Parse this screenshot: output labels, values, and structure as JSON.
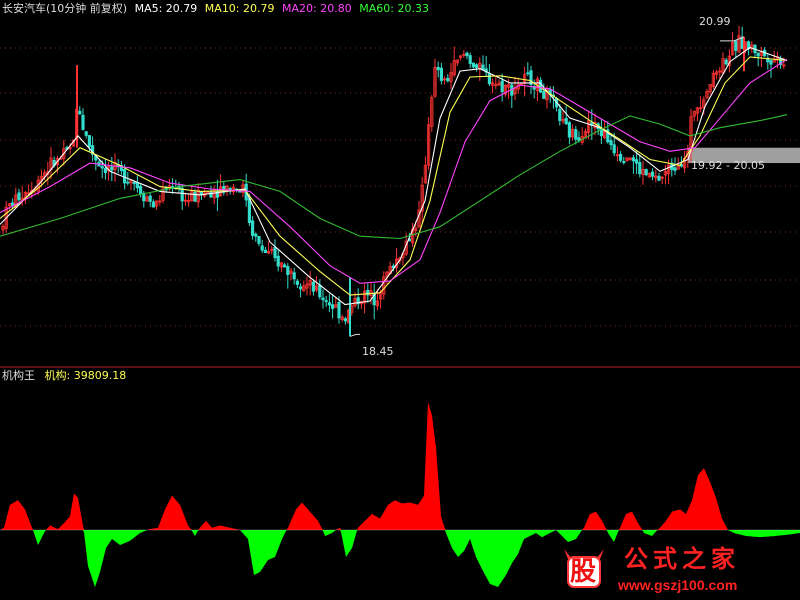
{
  "main_header": {
    "title": "长安汽车(10分钟 前复权)",
    "ma": [
      {
        "label": "MA5: 20.79",
        "color": "#ffffff"
      },
      {
        "label": "MA10: 20.79",
        "color": "#ffff55"
      },
      {
        "label": "MA20: 20.80",
        "color": "#ff44ff"
      },
      {
        "label": "MA60: 20.33",
        "color": "#33ff33"
      }
    ]
  },
  "annotations": {
    "high": "20.99",
    "low": "18.45",
    "range": "19.92 - 20.05"
  },
  "sub_header": {
    "title": "机构王",
    "indicator": "机构: 39809.18"
  },
  "watermark": {
    "logo_char": "股",
    "name": "公式之家",
    "url": "www.gszj100.com"
  },
  "colors": {
    "up": "#ff3333",
    "down": "#33ddcc",
    "pos": "#ff0000",
    "neg": "#00ff00",
    "ma5": "#ffffff",
    "ma10": "#ffff55",
    "ma20": "#ff44ff",
    "ma60": "#33bb33",
    "grid": "#882222",
    "divider": "#bb2222"
  },
  "chart_data": [
    {
      "type": "candlestick",
      "title": "长安汽车(10分钟 前复权)",
      "ylim": [
        18.25,
        21.15
      ],
      "series": [
        {
          "name": "MA5",
          "values": [
            20.79
          ]
        },
        {
          "name": "MA10",
          "values": [
            20.79
          ]
        },
        {
          "name": "MA20",
          "values": [
            20.8
          ]
        },
        {
          "name": "MA60",
          "values": [
            20.33
          ]
        }
      ],
      "high": 20.99,
      "low": 18.45,
      "range_box": [
        19.92,
        20.05
      ],
      "price_path": [
        [
          0,
          19.35
        ],
        [
          8,
          19.55
        ],
        [
          20,
          19.65
        ],
        [
          35,
          19.75
        ],
        [
          50,
          19.9
        ],
        [
          60,
          19.95
        ],
        [
          72,
          20.05
        ],
        [
          78,
          20.45
        ],
        [
          82,
          20.25
        ],
        [
          90,
          20.05
        ],
        [
          100,
          19.9
        ],
        [
          115,
          19.85
        ],
        [
          130,
          19.8
        ],
        [
          145,
          19.65
        ],
        [
          155,
          19.55
        ],
        [
          165,
          19.7
        ],
        [
          175,
          19.75
        ],
        [
          185,
          19.6
        ],
        [
          200,
          19.65
        ],
        [
          215,
          19.7
        ],
        [
          230,
          19.72
        ],
        [
          245,
          19.7
        ],
        [
          250,
          19.4
        ],
        [
          260,
          19.2
        ],
        [
          275,
          19.1
        ],
        [
          290,
          19.0
        ],
        [
          305,
          18.9
        ],
        [
          320,
          18.8
        ],
        [
          335,
          18.7
        ],
        [
          345,
          18.6
        ],
        [
          355,
          18.75
        ],
        [
          365,
          18.8
        ],
        [
          375,
          18.78
        ],
        [
          385,
          18.95
        ],
        [
          400,
          19.15
        ],
        [
          410,
          19.3
        ],
        [
          420,
          19.5
        ],
        [
          425,
          19.9
        ],
        [
          430,
          20.4
        ],
        [
          435,
          20.7
        ],
        [
          445,
          20.6
        ],
        [
          455,
          20.75
        ],
        [
          465,
          20.85
        ],
        [
          480,
          20.7
        ],
        [
          495,
          20.6
        ],
        [
          510,
          20.55
        ],
        [
          520,
          20.6
        ],
        [
          530,
          20.65
        ],
        [
          540,
          20.55
        ],
        [
          555,
          20.4
        ],
        [
          565,
          20.2
        ],
        [
          575,
          20.15
        ],
        [
          590,
          20.25
        ],
        [
          600,
          20.2
        ],
        [
          610,
          20.1
        ],
        [
          620,
          20.0
        ],
        [
          630,
          19.98
        ],
        [
          640,
          19.85
        ],
        [
          650,
          19.8
        ],
        [
          660,
          19.78
        ],
        [
          670,
          19.88
        ],
        [
          680,
          19.95
        ],
        [
          688,
          20.0
        ],
        [
          692,
          20.35
        ],
        [
          700,
          20.45
        ],
        [
          710,
          20.6
        ],
        [
          720,
          20.75
        ],
        [
          730,
          20.85
        ],
        [
          740,
          20.95
        ],
        [
          750,
          20.9
        ],
        [
          760,
          20.85
        ],
        [
          770,
          20.82
        ],
        [
          780,
          20.8
        ],
        [
          787,
          20.75
        ]
      ],
      "ma_paths": {
        "MA5": [
          [
            0,
            19.4
          ],
          [
            40,
            19.75
          ],
          [
            78,
            20.15
          ],
          [
            110,
            19.85
          ],
          [
            160,
            19.68
          ],
          [
            200,
            19.65
          ],
          [
            245,
            19.7
          ],
          [
            270,
            19.25
          ],
          [
            310,
            18.95
          ],
          [
            345,
            18.72
          ],
          [
            370,
            18.75
          ],
          [
            400,
            19.1
          ],
          [
            425,
            19.6
          ],
          [
            440,
            20.3
          ],
          [
            460,
            20.7
          ],
          [
            480,
            20.72
          ],
          [
            510,
            20.6
          ],
          [
            540,
            20.6
          ],
          [
            570,
            20.3
          ],
          [
            600,
            20.22
          ],
          [
            630,
            20.05
          ],
          [
            660,
            19.85
          ],
          [
            688,
            19.95
          ],
          [
            705,
            20.4
          ],
          [
            730,
            20.78
          ],
          [
            750,
            20.9
          ],
          [
            787,
            20.79
          ]
        ],
        "MA10": [
          [
            0,
            19.45
          ],
          [
            40,
            19.72
          ],
          [
            80,
            20.05
          ],
          [
            120,
            19.9
          ],
          [
            160,
            19.72
          ],
          [
            200,
            19.68
          ],
          [
            245,
            19.69
          ],
          [
            280,
            19.3
          ],
          [
            320,
            19.0
          ],
          [
            350,
            18.8
          ],
          [
            380,
            18.82
          ],
          [
            410,
            19.1
          ],
          [
            430,
            19.6
          ],
          [
            450,
            20.35
          ],
          [
            470,
            20.65
          ],
          [
            500,
            20.66
          ],
          [
            530,
            20.62
          ],
          [
            560,
            20.45
          ],
          [
            590,
            20.28
          ],
          [
            620,
            20.12
          ],
          [
            650,
            19.95
          ],
          [
            680,
            19.9
          ],
          [
            700,
            20.15
          ],
          [
            725,
            20.6
          ],
          [
            750,
            20.82
          ],
          [
            787,
            20.79
          ]
        ],
        "MA20": [
          [
            0,
            19.5
          ],
          [
            50,
            19.72
          ],
          [
            90,
            19.92
          ],
          [
            130,
            19.88
          ],
          [
            170,
            19.75
          ],
          [
            210,
            19.7
          ],
          [
            250,
            19.68
          ],
          [
            290,
            19.38
          ],
          [
            330,
            19.05
          ],
          [
            360,
            18.9
          ],
          [
            390,
            18.92
          ],
          [
            420,
            19.1
          ],
          [
            440,
            19.5
          ],
          [
            465,
            20.1
          ],
          [
            490,
            20.45
          ],
          [
            520,
            20.58
          ],
          [
            550,
            20.55
          ],
          [
            580,
            20.4
          ],
          [
            610,
            20.25
          ],
          [
            640,
            20.1
          ],
          [
            670,
            20.02
          ],
          [
            695,
            20.05
          ],
          [
            720,
            20.3
          ],
          [
            750,
            20.6
          ],
          [
            787,
            20.8
          ]
        ],
        "MA60": [
          [
            0,
            19.3
          ],
          [
            60,
            19.45
          ],
          [
            120,
            19.62
          ],
          [
            180,
            19.72
          ],
          [
            240,
            19.78
          ],
          [
            280,
            19.68
          ],
          [
            320,
            19.45
          ],
          [
            360,
            19.3
          ],
          [
            400,
            19.28
          ],
          [
            440,
            19.38
          ],
          [
            480,
            19.6
          ],
          [
            520,
            19.82
          ],
          [
            560,
            20.02
          ],
          [
            600,
            20.2
          ],
          [
            630,
            20.32
          ],
          [
            660,
            20.25
          ],
          [
            690,
            20.15
          ],
          [
            720,
            20.22
          ],
          [
            760,
            20.28
          ],
          [
            787,
            20.33
          ]
        ]
      }
    },
    {
      "type": "area",
      "title": "机构王",
      "series": [
        {
          "name": "机构",
          "values": [
            39809.18
          ]
        }
      ],
      "ylim": [
        -1,
        3.1
      ],
      "path": [
        [
          0,
          0
        ],
        [
          4,
          0.05
        ],
        [
          10,
          0.55
        ],
        [
          18,
          0.65
        ],
        [
          25,
          0.45
        ],
        [
          32,
          0.05
        ],
        [
          38,
          -0.25
        ],
        [
          44,
          -0.05
        ],
        [
          50,
          0.1
        ],
        [
          58,
          0.02
        ],
        [
          64,
          0.15
        ],
        [
          70,
          0.3
        ],
        [
          74,
          0.8
        ],
        [
          78,
          0.7
        ],
        [
          83,
          0.1
        ],
        [
          88,
          -0.6
        ],
        [
          95,
          -0.95
        ],
        [
          100,
          -0.7
        ],
        [
          106,
          -0.3
        ],
        [
          112,
          -0.15
        ],
        [
          120,
          -0.25
        ],
        [
          130,
          -0.18
        ],
        [
          140,
          -0.05
        ],
        [
          150,
          0.02
        ],
        [
          158,
          0.05
        ],
        [
          165,
          0.45
        ],
        [
          172,
          0.75
        ],
        [
          180,
          0.55
        ],
        [
          188,
          0.1
        ],
        [
          195,
          -0.1
        ],
        [
          200,
          0.05
        ],
        [
          206,
          0.2
        ],
        [
          212,
          0.05
        ],
        [
          220,
          0.1
        ],
        [
          230,
          0.05
        ],
        [
          240,
          0.0
        ],
        [
          248,
          -0.15
        ],
        [
          254,
          -0.75
        ],
        [
          260,
          -0.7
        ],
        [
          268,
          -0.5
        ],
        [
          275,
          -0.45
        ],
        [
          282,
          -0.15
        ],
        [
          288,
          0.05
        ],
        [
          296,
          0.45
        ],
        [
          302,
          0.6
        ],
        [
          310,
          0.4
        ],
        [
          318,
          0.2
        ],
        [
          325,
          -0.1
        ],
        [
          332,
          -0.05
        ],
        [
          340,
          0.05
        ],
        [
          346,
          -0.45
        ],
        [
          352,
          -0.3
        ],
        [
          358,
          0.05
        ],
        [
          365,
          0.2
        ],
        [
          372,
          0.35
        ],
        [
          380,
          0.25
        ],
        [
          388,
          0.55
        ],
        [
          395,
          0.65
        ],
        [
          402,
          0.58
        ],
        [
          410,
          0.6
        ],
        [
          418,
          0.55
        ],
        [
          424,
          0.75
        ],
        [
          428,
          2.8
        ],
        [
          432,
          2.5
        ],
        [
          436,
          1.8
        ],
        [
          441,
          0.3
        ],
        [
          446,
          -0.05
        ],
        [
          452,
          -0.3
        ],
        [
          458,
          -0.45
        ],
        [
          464,
          -0.35
        ],
        [
          470,
          -0.15
        ],
        [
          476,
          -0.45
        ],
        [
          482,
          -0.65
        ],
        [
          490,
          -0.9
        ],
        [
          498,
          -0.95
        ],
        [
          506,
          -0.75
        ],
        [
          512,
          -0.55
        ],
        [
          518,
          -0.4
        ],
        [
          524,
          -0.15
        ],
        [
          530,
          -0.1
        ],
        [
          536,
          -0.05
        ],
        [
          542,
          -0.12
        ],
        [
          550,
          -0.05
        ],
        [
          556,
          0.0
        ],
        [
          562,
          -0.1
        ],
        [
          568,
          -0.2
        ],
        [
          576,
          -0.15
        ],
        [
          584,
          0.05
        ],
        [
          590,
          0.35
        ],
        [
          596,
          0.4
        ],
        [
          602,
          0.2
        ],
        [
          608,
          -0.05
        ],
        [
          614,
          -0.2
        ],
        [
          620,
          0.05
        ],
        [
          626,
          0.35
        ],
        [
          632,
          0.4
        ],
        [
          638,
          0.15
        ],
        [
          644,
          -0.05
        ],
        [
          652,
          -0.1
        ],
        [
          660,
          0.05
        ],
        [
          666,
          0.2
        ],
        [
          672,
          0.4
        ],
        [
          680,
          0.45
        ],
        [
          686,
          0.35
        ],
        [
          692,
          0.65
        ],
        [
          698,
          1.2
        ],
        [
          704,
          1.35
        ],
        [
          710,
          1.05
        ],
        [
          716,
          0.7
        ],
        [
          722,
          0.25
        ],
        [
          728,
          0.0
        ],
        [
          734,
          -0.05
        ],
        [
          746,
          -0.1
        ],
        [
          760,
          -0.12
        ],
        [
          775,
          -0.1
        ],
        [
          787,
          -0.08
        ],
        [
          800,
          -0.05
        ]
      ]
    }
  ]
}
